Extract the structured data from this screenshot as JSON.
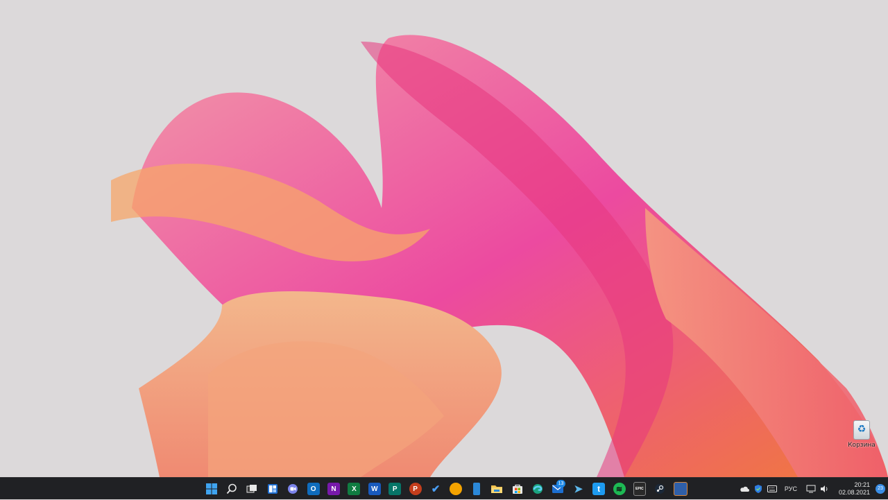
{
  "desktop": {
    "icons": [
      {
        "label": "Корзина",
        "icon": "recycle-bin-icon"
      }
    ]
  },
  "taskbar": {
    "apps": [
      {
        "name": "start",
        "icon": "windows-logo-icon"
      },
      {
        "name": "search",
        "icon": "search-icon"
      },
      {
        "name": "task-view",
        "icon": "task-view-icon"
      },
      {
        "name": "widgets",
        "icon": "widgets-icon"
      },
      {
        "name": "teams-chat",
        "icon": "chat-icon"
      },
      {
        "name": "outlook",
        "icon": "outlook-icon",
        "letter": "O",
        "color": "#0f6cbd"
      },
      {
        "name": "onenote",
        "icon": "onenote-icon",
        "letter": "N",
        "color": "#7719aa"
      },
      {
        "name": "excel",
        "icon": "excel-icon",
        "letter": "X",
        "color": "#107c41"
      },
      {
        "name": "word",
        "icon": "word-icon",
        "letter": "W",
        "color": "#185abd"
      },
      {
        "name": "publisher",
        "icon": "publisher-icon",
        "letter": "P",
        "color": "#077568"
      },
      {
        "name": "powerpoint",
        "icon": "powerpoint-icon",
        "letter": "P",
        "color": "#c43e1c"
      },
      {
        "name": "todo",
        "icon": "checkmark-icon",
        "letter": "✔",
        "color": "#2564cf"
      },
      {
        "name": "sticky-app",
        "icon": "app-icon",
        "letter": "",
        "color": "#f4a300"
      },
      {
        "name": "phone-app",
        "icon": "phone-icon",
        "letter": "",
        "color": "#2b88d8"
      },
      {
        "name": "file-explorer",
        "icon": "folder-icon",
        "letter": "",
        "color": "#f2c14e"
      },
      {
        "name": "store",
        "icon": "store-icon",
        "letter": "",
        "color": "#e8e8e8"
      },
      {
        "name": "edge",
        "icon": "edge-icon",
        "letter": "",
        "color": "#1ba380"
      },
      {
        "name": "mail",
        "icon": "mail-icon",
        "letter": "",
        "color": "#1c6fd1",
        "badge": "13"
      },
      {
        "name": "telegram",
        "icon": "telegram-icon",
        "letter": "➤",
        "color": "#2aa3df"
      },
      {
        "name": "twitter",
        "icon": "twitter-icon",
        "letter": "t",
        "color": "#1d9bf0"
      },
      {
        "name": "spotify",
        "icon": "spotify-icon",
        "letter": "≋",
        "color": "#1db954"
      },
      {
        "name": "epic-games",
        "icon": "epic-games-icon",
        "letter": "EPIC",
        "color": "#2a2a2a"
      },
      {
        "name": "steam",
        "icon": "steam-icon",
        "letter": "S",
        "color": "#1b2838"
      },
      {
        "name": "extra-app",
        "icon": "app-icon",
        "letter": "",
        "color": "#2f5fa8"
      }
    ],
    "tray": {
      "language": "РУС",
      "time": "20:21",
      "date": "02.08.2021",
      "notifications": "23"
    }
  }
}
